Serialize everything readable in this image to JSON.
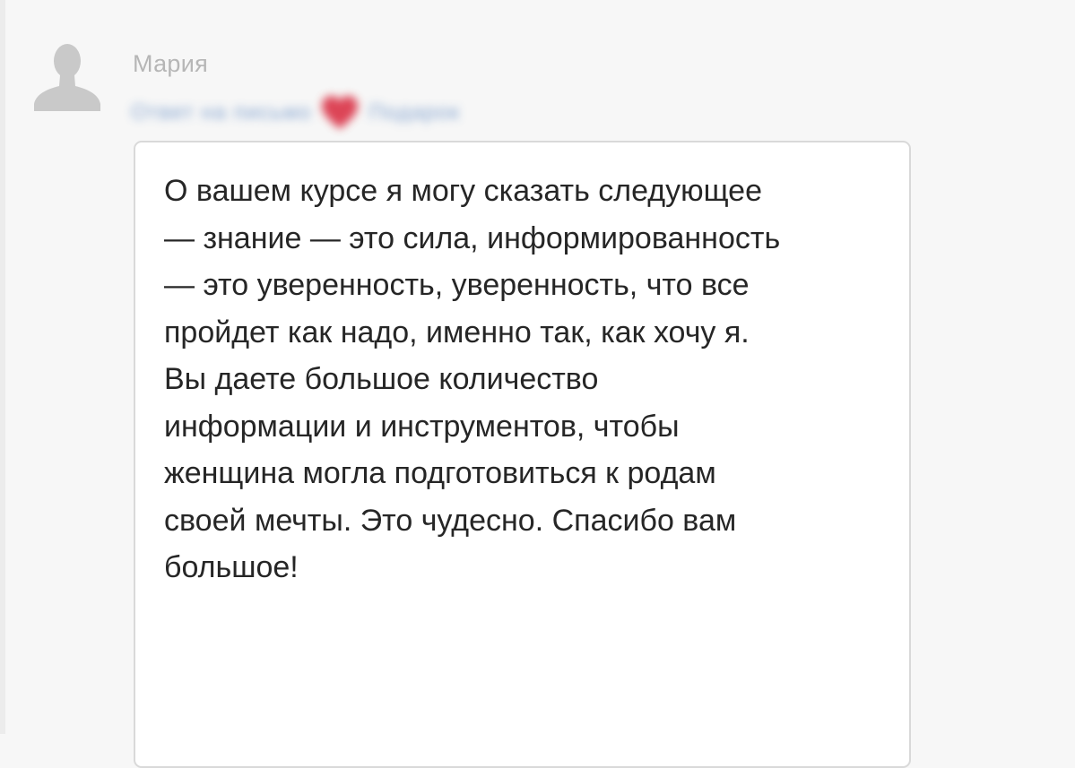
{
  "comment": {
    "author_name": "Мария",
    "avatar_icon": "default-user-avatar-icon",
    "subject_blurred": "Ответ на письмо",
    "subject_blurred_2": "Подарок",
    "heart_icon": "heart-icon",
    "heart_color": "#d8263b",
    "message": "О вашем курсе я могу сказать следующее\n— знание — это сила, информированность\n— это уверенность,  уверенность, что все\nпройдет как надо, именно так, как хочу я.\nВы даете большое количество\nинформации и инструментов, чтобы\nженщина могла подготовиться к родам\nсвоей мечты. Это чудесно. Спасибо вам\nбольшое!"
  }
}
